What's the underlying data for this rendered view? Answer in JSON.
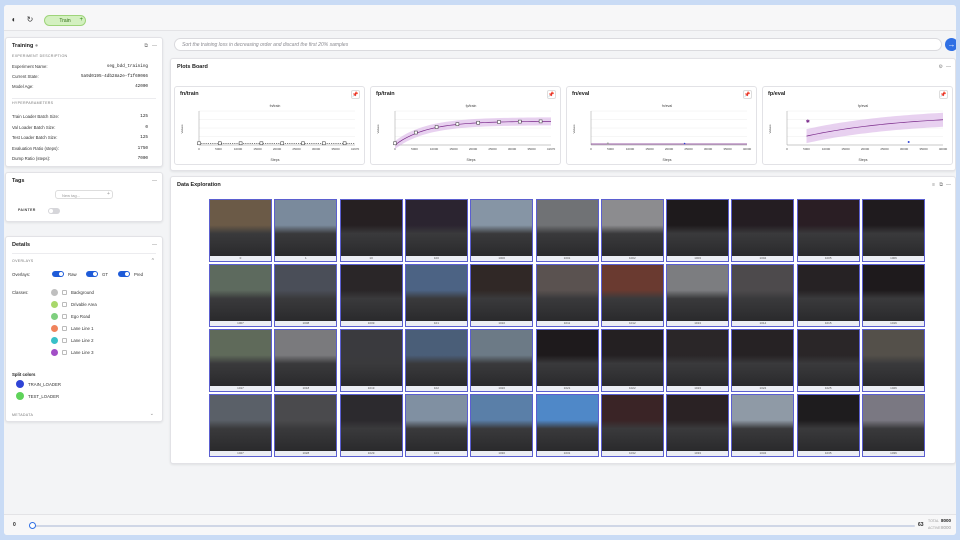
{
  "topbar": {
    "run_name": "Train"
  },
  "prompt": {
    "placeholder": "Sort the training loss in decreasing order and discard the first 20% samples"
  },
  "training": {
    "title": "Training",
    "section_experiment": "EXPERIMENT DESCRIPTION",
    "fields": [
      {
        "label": "Experiment Name:",
        "value": "seg_bdd_training"
      },
      {
        "label": "Current State:",
        "value": "5a9d0195-4db28a2e-f1f69066"
      },
      {
        "label": "Model Age:",
        "value": "42000"
      }
    ],
    "section_hyper": "HYPERPARAMETERS",
    "hyper": [
      {
        "label": "Train Loader Batch Size:",
        "value": "125"
      },
      {
        "label": "Val Loader Batch Size:",
        "value": "0"
      },
      {
        "label": "Test Loader Batch Size:",
        "value": "125"
      },
      {
        "label": "Evaluation Ratio (steps):",
        "value": "1750"
      },
      {
        "label": "Dump Ratio (steps):",
        "value": "7000"
      }
    ]
  },
  "tags": {
    "title": "Tags",
    "input_placeholder": "New tag...",
    "painter_label": "PAINTER"
  },
  "details": {
    "title": "Details",
    "overlays_section": "OVERLAYS",
    "overlays_label": "Overlays:",
    "overlay_raw": "Raw",
    "overlay_gt": "GT",
    "overlay_pred": "Pred",
    "classes_label": "Classes:",
    "classes": [
      {
        "name": "Background",
        "color": "#bfbfbf"
      },
      {
        "name": "Drivable Area",
        "color": "#a8d86b"
      },
      {
        "name": "Ego Road",
        "color": "#7fcf7f"
      },
      {
        "name": "Lane Line 1",
        "color": "#f0835c"
      },
      {
        "name": "Lane Line 2",
        "color": "#38c0c8"
      },
      {
        "name": "Lane Line 3",
        "color": "#a24ec6"
      }
    ],
    "split_title": "Split colors",
    "splits": [
      {
        "name": "TRAIN_LOADER",
        "color": "#2f44d6"
      },
      {
        "name": "TEST_LOADER",
        "color": "#5fd35a"
      }
    ],
    "metadata_section": "METADATA"
  },
  "plots": {
    "title": "Plots Board",
    "charts": [
      {
        "id": "fn-train",
        "title": "fn/train",
        "inner": "fn/train",
        "ylabel": "Values",
        "xlabel": "Steps",
        "color": "#333",
        "ticks": [
          "0",
          "5000",
          "10000",
          "15000",
          "20000",
          "25000",
          "30000",
          "35000",
          "41970"
        ]
      },
      {
        "id": "fp-train",
        "title": "fp/train",
        "inner": "fp/train",
        "ylabel": "Values",
        "xlabel": "Steps",
        "color": "#7a2a8a",
        "ticks": [
          "0",
          "5000",
          "10000",
          "15000",
          "20000",
          "25000",
          "30000",
          "35000",
          "41970"
        ]
      },
      {
        "id": "fn-eval",
        "title": "fn/eval",
        "inner": "fn/eval",
        "ylabel": "Values",
        "xlabel": "Steps",
        "color": "#7a2a8a",
        "ticks": [
          "0",
          "5000",
          "10000",
          "15000",
          "20000",
          "25000",
          "30000",
          "35000",
          "40000"
        ]
      },
      {
        "id": "fp-eval",
        "title": "fp/eval",
        "inner": "fp/eval",
        "ylabel": "Values",
        "xlabel": "Steps",
        "color": "#7a2a8a",
        "ticks": [
          "0",
          "5000",
          "10000",
          "15000",
          "20000",
          "25000",
          "30000",
          "35000",
          "40000"
        ]
      }
    ]
  },
  "data_exploration": {
    "title": "Data Exploration",
    "samples": [
      {
        "id": "0",
        "c": "#6b5a47"
      },
      {
        "id": "1",
        "c": "#7a8a9c"
      },
      {
        "id": "10",
        "c": "#262022"
      },
      {
        "id": "100",
        "c": "#2b2430"
      },
      {
        "id": "1000",
        "c": "#8695a5"
      },
      {
        "id": "1001",
        "c": "#707275"
      },
      {
        "id": "1002",
        "c": "#8c8c8f"
      },
      {
        "id": "1003",
        "c": "#1e1a1c"
      },
      {
        "id": "1004",
        "c": "#241d22"
      },
      {
        "id": "1005",
        "c": "#2a1e24"
      },
      {
        "id": "1006",
        "c": "#1f1b1e"
      },
      {
        "id": "1007",
        "c": "#5d6a5e"
      },
      {
        "id": "1008",
        "c": "#4a4e58"
      },
      {
        "id": "1009",
        "c": "#2a2628"
      },
      {
        "id": "101",
        "c": "#4c6384"
      },
      {
        "id": "1010",
        "c": "#302826"
      },
      {
        "id": "1011",
        "c": "#5a5250"
      },
      {
        "id": "1012",
        "c": "#6a3a30"
      },
      {
        "id": "1013",
        "c": "#7c7d80"
      },
      {
        "id": "1014",
        "c": "#4d4a4c"
      },
      {
        "id": "1015",
        "c": "#262224"
      },
      {
        "id": "1016",
        "c": "#1e1a1c"
      },
      {
        "id": "1017",
        "c": "#5f6a5a"
      },
      {
        "id": "1018",
        "c": "#7a7a7d"
      },
      {
        "id": "1019",
        "c": "#3a3a3e"
      },
      {
        "id": "102",
        "c": "#4a5e78"
      },
      {
        "id": "1020",
        "c": "#6c7a86"
      },
      {
        "id": "1021",
        "c": "#1e1a1c"
      },
      {
        "id": "1022",
        "c": "#242022"
      },
      {
        "id": "1023",
        "c": "#2a2628"
      },
      {
        "id": "1024",
        "c": "#262224"
      },
      {
        "id": "1025",
        "c": "#2a2628"
      },
      {
        "id": "1026",
        "c": "#54504a"
      },
      {
        "id": "1027",
        "c": "#5a6068"
      },
      {
        "id": "1028",
        "c": "#4a4a4d"
      },
      {
        "id": "1029",
        "c": "#2c2a2e"
      },
      {
        "id": "103",
        "c": "#8090a2"
      },
      {
        "id": "1030",
        "c": "#5a7fa8"
      },
      {
        "id": "1031",
        "c": "#4f88c8"
      },
      {
        "id": "1032",
        "c": "#3a2426"
      },
      {
        "id": "1033",
        "c": "#2a2224"
      },
      {
        "id": "1034",
        "c": "#8f9aa6"
      },
      {
        "id": "1035",
        "c": "#1e1c1e"
      },
      {
        "id": "1036",
        "c": "#7a7882"
      }
    ]
  },
  "bottom": {
    "start": "0",
    "end": "63",
    "total_label": "TOTAL",
    "total": "8000",
    "active_label": "ACTIVE",
    "active": "8000"
  }
}
